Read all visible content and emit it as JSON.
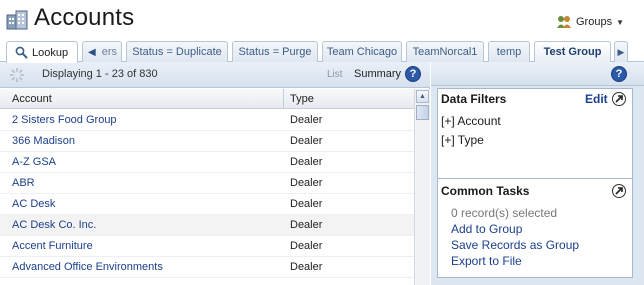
{
  "header": {
    "title": "Accounts",
    "groups_label": "Groups"
  },
  "tabs": {
    "lookup": "Lookup",
    "partial": "ers",
    "items": [
      "Status = Duplicate",
      "Status = Purge",
      "Team Chicago",
      "TeamNorcal1",
      "temp",
      "Test Group"
    ]
  },
  "grid": {
    "display_text": "Displaying 1 - 23 of 830",
    "list_label": "List",
    "summary_label": "Summary",
    "columns": [
      "Account",
      "Type"
    ],
    "rows": [
      {
        "account": "2 Sisters Food Group",
        "type": "Dealer"
      },
      {
        "account": "366 Madison",
        "type": "Dealer"
      },
      {
        "account": "A-Z GSA",
        "type": "Dealer"
      },
      {
        "account": "ABR",
        "type": "Dealer"
      },
      {
        "account": "AC Desk",
        "type": "Dealer"
      },
      {
        "account": "AC Desk Co. Inc.",
        "type": "Dealer"
      },
      {
        "account": "Accent Furniture",
        "type": "Dealer"
      },
      {
        "account": "Advanced Office Environments",
        "type": "Dealer"
      }
    ]
  },
  "filters": {
    "title": "Data Filters",
    "edit_label": "Edit",
    "items": [
      "[+] Account",
      "[+] Type"
    ]
  },
  "tasks": {
    "title": "Common Tasks",
    "selected_text": "0 record(s) selected",
    "links": [
      "Add to Group",
      "Save Records as Group",
      "Export to File"
    ]
  },
  "help_glyph": "?",
  "colors": {
    "link": "#1c3f8c",
    "tab_text": "#3d5c86",
    "help_blue": "#2c5aa8",
    "side_bg": "#dde7f2"
  }
}
